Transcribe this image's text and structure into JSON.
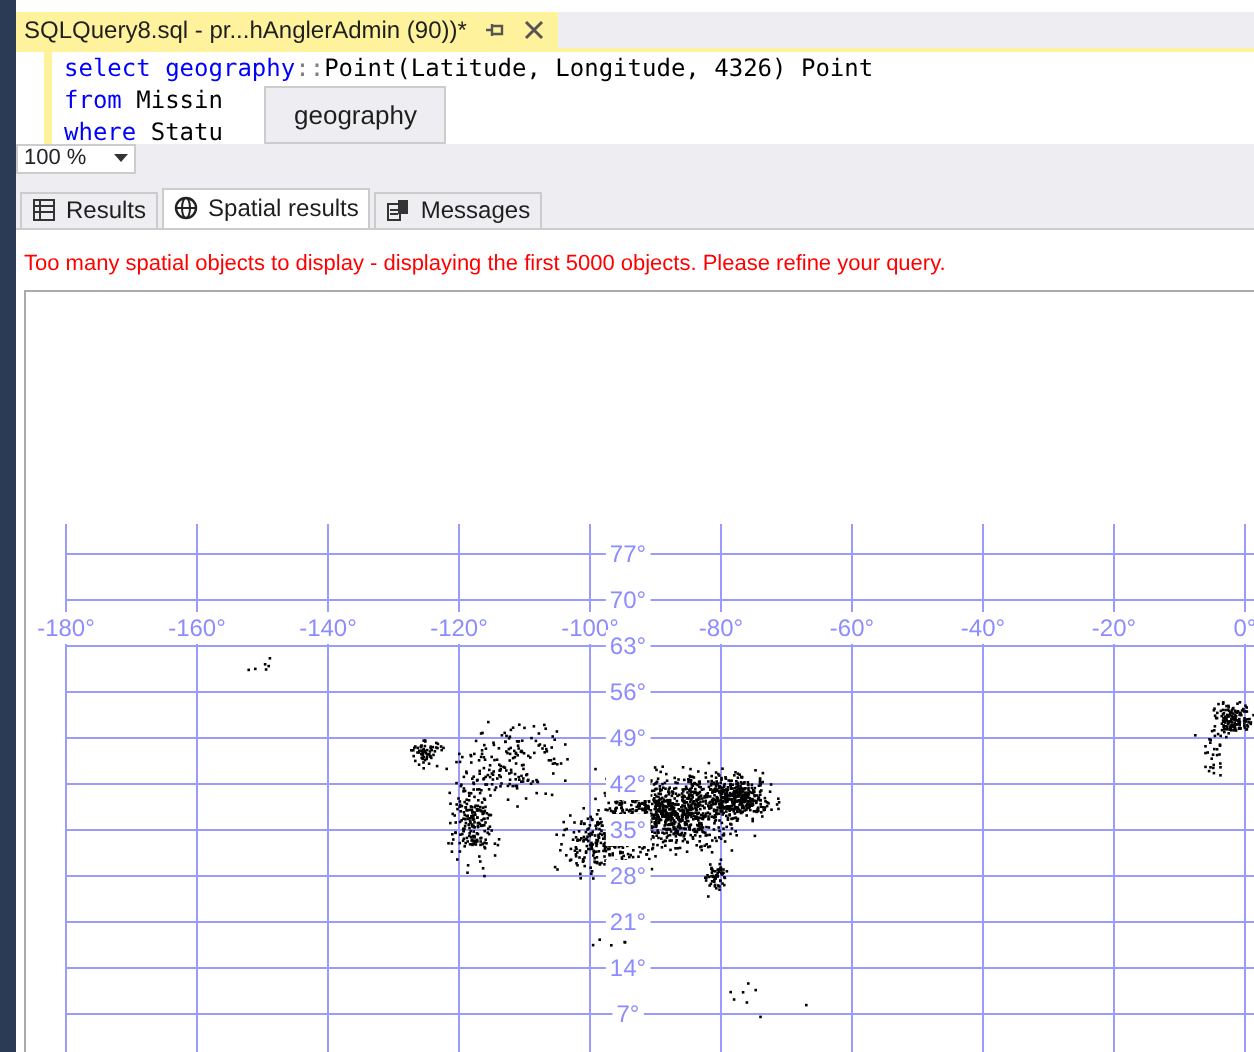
{
  "document_tab": {
    "title": "SQLQuery8.sql - pr...hAnglerAdmin (90))*",
    "selected": true
  },
  "editor": {
    "lines": [
      [
        {
          "kind": "keyword",
          "text": "select"
        },
        {
          "kind": "keyword",
          "text": " geography"
        },
        {
          "kind": "operator",
          "text": "::"
        },
        {
          "kind": "plain",
          "text": "Point(Latitude, Longitude, 4326) Point"
        }
      ],
      [
        {
          "kind": "keyword",
          "text": "from"
        },
        {
          "kind": "plain",
          "text": " Missin"
        }
      ],
      [
        {
          "kind": "keyword",
          "text": "where"
        },
        {
          "kind": "plain",
          "text": " Statu"
        }
      ]
    ],
    "tooltip": "geography"
  },
  "zoom": {
    "value": "100 %"
  },
  "result_tabs": [
    {
      "label": "Results",
      "selected": false
    },
    {
      "label": "Spatial results",
      "selected": true
    },
    {
      "label": "Messages",
      "selected": false
    }
  ],
  "warning": "Too many spatial objects to display - displaying the first 5000 objects. Please refine your query.",
  "map": {
    "longitude_labels": [
      "-180°",
      "-160°",
      "-140°",
      "-120°",
      "-100°",
      "-80°",
      "-60°",
      "-40°",
      "-20°",
      "0°"
    ],
    "latitude_labels": [
      "77°",
      "70°",
      "63°",
      "56°",
      "49°",
      "42°",
      "35°",
      "28°",
      "21°",
      "14°",
      "7°"
    ]
  }
}
